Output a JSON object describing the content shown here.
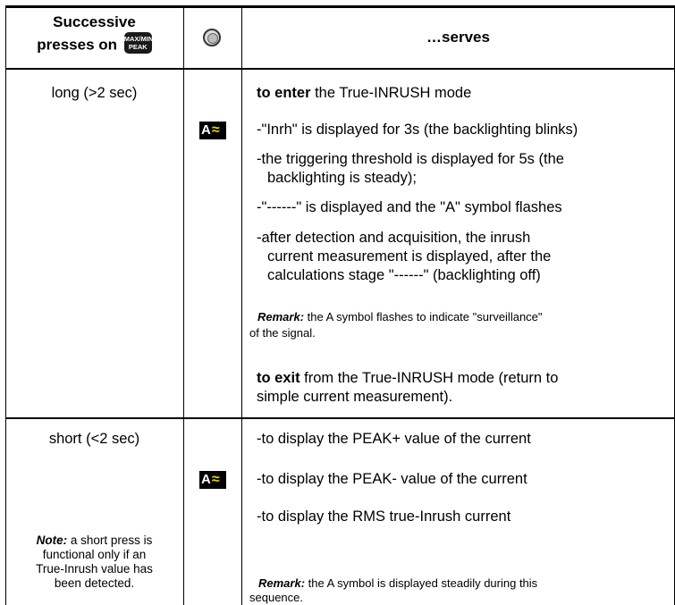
{
  "header": {
    "col1_line1": "Successive",
    "col1_line2": "presses on",
    "key_top": "MAX/MIN",
    "key_bottom": "PEAK",
    "col3": "…serves"
  },
  "long": {
    "press_label": "long (>2 sec)",
    "enter_bold": "to enter",
    "enter_rest": " the True-INRUSH mode",
    "steps": [
      "-\"Inrh\" is displayed for 3s (the backlighting blinks)",
      "-the triggering threshold is displayed for 5s (the",
      "backlighting is steady);",
      "-\"------\" is displayed and the \"A\" symbol flashes",
      "-after detection and acquisition, the inrush",
      "current measurement is displayed, after the",
      "calculations stage \"------\" (backlighting off)"
    ],
    "remark_label": "Remark:",
    "remark_rest": " the A symbol flashes to indicate \"surveillance\"",
    "remark_line2": "of the signal.",
    "exit_bold": "to exit",
    "exit_rest": " from the True-INRUSH mode (return to",
    "exit_line2": "simple current measurement)."
  },
  "short": {
    "press_label": "short (<2 sec)",
    "note_label": "Note:",
    "note_rest": " a short press is",
    "note_line2": "functional only if an",
    "note_line3": "True-Inrush value has",
    "note_line4": "been detected.",
    "items": [
      "-to display the PEAK+ value of the current",
      "-to display the PEAK- value of the current",
      "-to display the RMS true-Inrush current"
    ],
    "remark_label": "Remark:",
    "remark_rest": " the A symbol is displayed steadily during this",
    "remark_line2": "sequence."
  },
  "icons": {
    "mode_icon_letter": "A",
    "mode_icon_wave": "≈"
  }
}
